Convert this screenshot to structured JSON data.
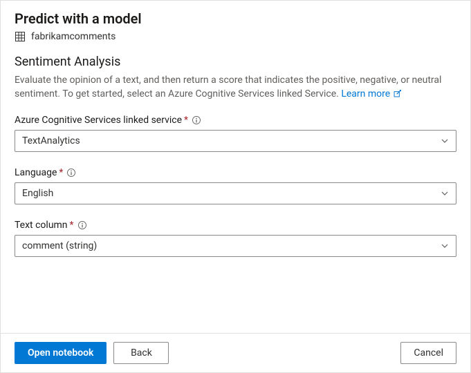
{
  "header": {
    "title": "Predict with a model",
    "dataset_name": "fabrikamcomments"
  },
  "section": {
    "title": "Sentiment Analysis",
    "description": "Evaluate the opinion of a text, and then return a score that indicates the positive, negative, or neutral sentiment. To get started, select an Azure Cognitive Services linked Service. ",
    "learn_more_label": "Learn more"
  },
  "fields": {
    "linked_service": {
      "label": "Azure Cognitive Services linked service",
      "value": "TextAnalytics"
    },
    "language": {
      "label": "Language",
      "value": "English"
    },
    "text_column": {
      "label": "Text column",
      "value": "comment (string)"
    }
  },
  "footer": {
    "open_notebook": "Open notebook",
    "back": "Back",
    "cancel": "Cancel"
  }
}
